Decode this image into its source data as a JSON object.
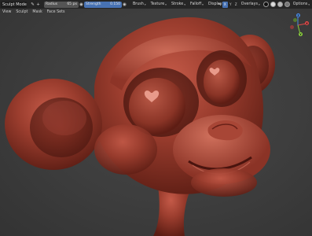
{
  "header": {
    "mode": "Sculpt Mode",
    "radius_label": "Radius",
    "radius_value": "65 px",
    "strength_label": "Strength",
    "strength_value": "0.150",
    "menus": [
      {
        "label": "Brush"
      },
      {
        "label": "Texture"
      },
      {
        "label": "Stroke"
      },
      {
        "label": "Falloff"
      },
      {
        "label": "Display"
      }
    ],
    "right_menus": [
      {
        "label": "Overlays"
      },
      {
        "label": "Options"
      }
    ]
  },
  "subheader": {
    "items": [
      {
        "label": "View"
      },
      {
        "label": "Sculpt"
      },
      {
        "label": "Mask"
      },
      {
        "label": "Face Sets"
      }
    ]
  },
  "gizmo": {
    "x": "X",
    "y": "Y",
    "z": "Z"
  },
  "colors": {
    "accent": "#4772b3",
    "sculpt_base": "#8a3326",
    "background": "#3d3d3d"
  },
  "icons": {
    "brush": "brush-icon",
    "symmetry": "symmetry-icon",
    "wireframe": "wireframe-icon"
  }
}
